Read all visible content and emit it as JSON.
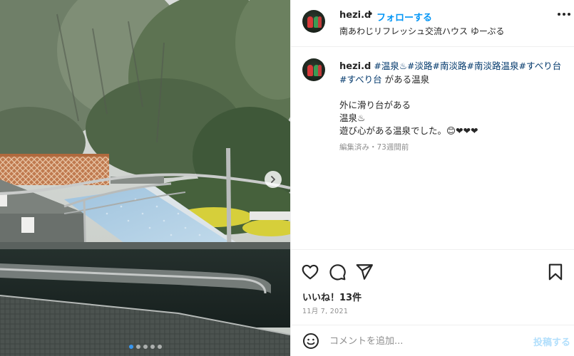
{
  "post": {
    "username": "hezi.d",
    "separator": "•",
    "follow_label": "フォローする",
    "location": "南あわじリフレッシュ交流ハウス ゆーぷる"
  },
  "caption": {
    "username": "hezi.d",
    "hashtags_line1": [
      "#温泉♨",
      "#淡路",
      "#南淡路",
      "#南淡路温泉",
      "#すべり"
    ],
    "hashtag_line2_a": "台",
    "hashtag_line2_b": "#すべり台",
    "line2_suffix": " がある温泉",
    "line3": "外に滑り台がある",
    "line4": "温泉♨",
    "line5": "遊び心がある温泉でした。😊❤❤❤",
    "meta": "編集済み・73週間前"
  },
  "actions": {
    "like_icon": "heart-icon",
    "comment_icon": "comment-icon",
    "share_icon": "share-icon",
    "save_icon": "bookmark-icon"
  },
  "likes_text": "いいね！13件",
  "date_text": "11月 7, 2021",
  "comment": {
    "placeholder": "コメントを追加...",
    "post_label": "投稿する",
    "emoji_icon": "smiley-icon"
  },
  "carousel": {
    "slide_count": 5,
    "active_index": 0,
    "next_icon": "chevron-right-icon"
  },
  "colors": {
    "link_blue": "#0095f6",
    "hashtag": "#00376b",
    "post_disabled": "#b2dffc",
    "muted": "#8e8e8e"
  }
}
